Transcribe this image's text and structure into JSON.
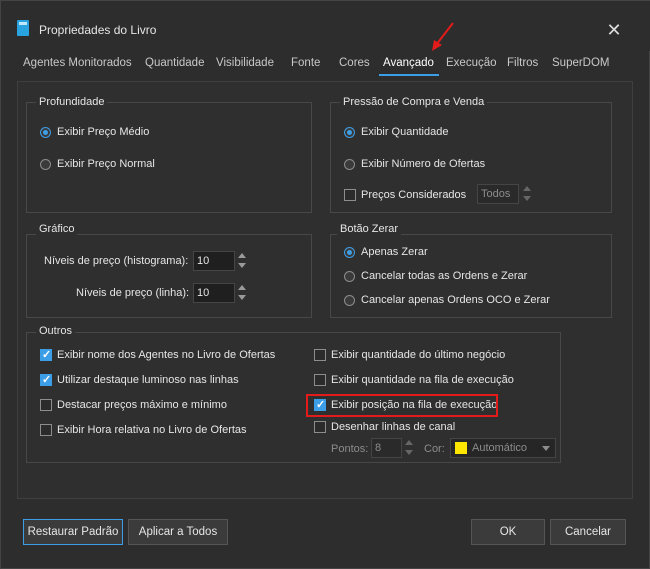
{
  "window": {
    "title": "Propriedades do Livro"
  },
  "tabs": [
    "Agentes Monitorados",
    "Quantidade",
    "Visibilidade",
    "Fonte",
    "Cores",
    "Avançado",
    "Execução",
    "Filtros",
    "SuperDOM"
  ],
  "active_tab": "Avançado",
  "profundidade": {
    "title": "Profundidade",
    "options": [
      "Exibir Preço Médio",
      "Exibir Preço Normal"
    ],
    "selected": "Exibir Preço Médio"
  },
  "pressao": {
    "title": "Pressão de Compra e Venda",
    "options": [
      "Exibir Quantidade",
      "Exibir Número de Ofertas"
    ],
    "selected": "Exibir Quantidade",
    "precos_label": "Preços Considerados",
    "precos_value": "Todos"
  },
  "grafico": {
    "title": "Gráfico",
    "histograma_label": "Níveis de preço (histograma):",
    "histograma_value": "10",
    "linha_label": "Níveis de preço (linha):",
    "linha_value": "10"
  },
  "zerar": {
    "title": "Botão Zerar",
    "options": [
      "Apenas Zerar",
      "Cancelar todas as Ordens e Zerar",
      "Cancelar apenas Ordens OCO e Zerar"
    ],
    "selected": "Apenas Zerar"
  },
  "outros": {
    "title": "Outros",
    "left": [
      {
        "label": "Exibir nome dos Agentes no Livro de Ofertas",
        "checked": true
      },
      {
        "label": "Utilizar destaque luminoso nas linhas",
        "checked": true
      },
      {
        "label": "Destacar preços máximo e mínimo",
        "checked": false
      },
      {
        "label": "Exibir Hora relativa no Livro de Ofertas",
        "checked": false
      }
    ],
    "right": [
      {
        "label": "Exibir quantidade do último negócio",
        "checked": false
      },
      {
        "label": "Exibir quantidade na fila de execução",
        "checked": false
      },
      {
        "label": "Exibir posição na fila de execução",
        "checked": true
      },
      {
        "label": "Desenhar linhas de canal",
        "checked": false
      }
    ],
    "pontos_label": "Pontos:",
    "pontos_value": "8",
    "cor_label": "Cor:",
    "cor_value": "Automático",
    "cor_color": "#ffe600"
  },
  "buttons": {
    "restore": "Restaurar Padrão",
    "apply_all": "Aplicar a Todos",
    "ok": "OK",
    "cancel": "Cancelar"
  },
  "colors": {
    "accent": "#3d9ee8",
    "annotation": "#e31b1b"
  }
}
